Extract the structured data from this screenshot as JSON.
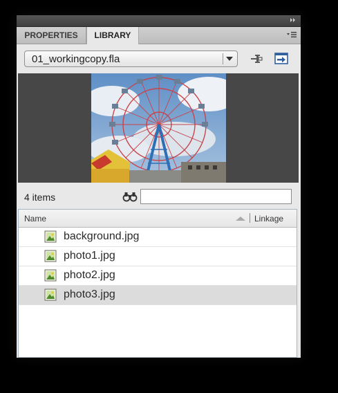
{
  "tabs": [
    {
      "label": "PROPERTIES",
      "active": false
    },
    {
      "label": "LIBRARY",
      "active": true
    }
  ],
  "document_select": {
    "value": "01_workingcopy.fla"
  },
  "item_count": "4 items",
  "search": {
    "value": "",
    "placeholder": ""
  },
  "columns": {
    "name": "Name",
    "linkage": "Linkage"
  },
  "items": [
    {
      "name": "background.jpg",
      "icon": "bitmap-icon",
      "selected": false
    },
    {
      "name": "photo1.jpg",
      "icon": "bitmap-icon",
      "selected": false
    },
    {
      "name": "photo2.jpg",
      "icon": "bitmap-icon",
      "selected": false
    },
    {
      "name": "photo3.jpg",
      "icon": "bitmap-icon",
      "selected": true
    }
  ],
  "colors": {
    "panel_bg": "#e8e8e8",
    "preview_bg": "#474747",
    "selected_row": "#dcdcdc",
    "list_border": "#a7b4c4"
  }
}
